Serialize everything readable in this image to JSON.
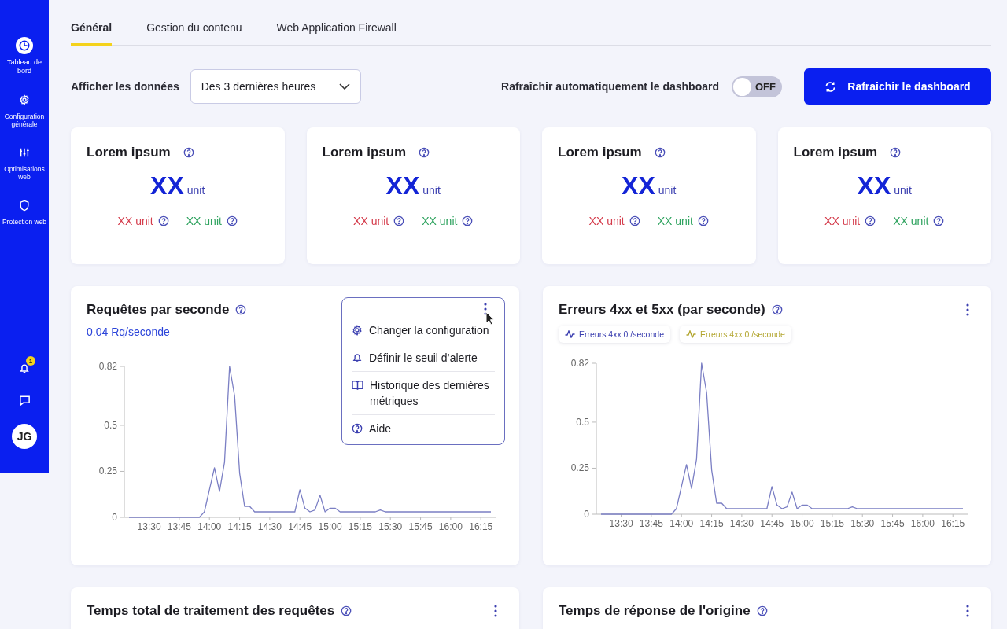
{
  "sidebar": {
    "items": [
      {
        "label": "Tableau de bord",
        "selected": true
      },
      {
        "label": "Configuration générale",
        "selected": false
      },
      {
        "label": "Optimisations web",
        "selected": false
      },
      {
        "label": "Protection web",
        "selected": false
      }
    ],
    "notifications": {
      "badge": "1"
    },
    "avatar": "JG"
  },
  "tabs": [
    {
      "label": "Général",
      "selected": true
    },
    {
      "label": "Gestion du contenu",
      "selected": false
    },
    {
      "label": "Web Application Firewall",
      "selected": false
    }
  ],
  "toolbar": {
    "range_label": "Afficher les données",
    "range_value": "Des 3 dernières heures",
    "auto_refresh_label": "Rafraîchir automatiquement le dashboard",
    "auto_refresh": {
      "on": false,
      "label": "OFF"
    },
    "refresh_button": "Rafraichir le dashboard"
  },
  "stats": [
    {
      "title": "Lorem ipsum",
      "value": "XX",
      "unit": "unit",
      "bad": "XX unit",
      "good": "XX unit"
    },
    {
      "title": "Lorem ipsum",
      "value": "XX",
      "unit": "unit",
      "bad": "XX unit",
      "good": "XX unit"
    },
    {
      "title": "Lorem ipsum",
      "value": "XX",
      "unit": "unit",
      "bad": "XX unit",
      "good": "XX unit"
    },
    {
      "title": "Lorem ipsum",
      "value": "XX",
      "unit": "unit",
      "bad": "XX unit",
      "good": "XX unit"
    }
  ],
  "panels": [
    {
      "title": "Requêtes par seconde",
      "subtitle": "0.04 Rq/seconde",
      "menu": [
        {
          "label": "Changer la configuration"
        },
        {
          "label": "Définir le seuil d’alerte"
        },
        {
          "label": "Historique des dernières métriques"
        },
        {
          "label": "Aide"
        }
      ],
      "chart_data": {
        "type": "line",
        "categories": [
          null,
          null,
          null,
          null,
          "13:30",
          null,
          null,
          null,
          null,
          null,
          "13:45",
          null,
          null,
          null,
          null,
          null,
          "14:00",
          null,
          null,
          null,
          null,
          null,
          "14:15",
          null,
          null,
          null,
          null,
          null,
          "14:30",
          null,
          null,
          null,
          null,
          null,
          "14:45",
          null,
          null,
          null,
          null,
          null,
          "15:00",
          null,
          null,
          null,
          null,
          null,
          "15:15",
          null,
          null,
          null,
          null,
          null,
          "15:30",
          null,
          null,
          null,
          null,
          null,
          "15:45",
          null,
          null,
          null,
          null,
          null,
          "16:00",
          null,
          null,
          null,
          null,
          null,
          "16:15",
          null,
          null
        ],
        "series": [
          {
            "color": "#7b7fc4",
            "values": [
              0,
              0,
              0,
              0,
              0,
              0,
              0,
              0,
              0,
              0,
              0,
              0,
              0,
              0,
              0,
              0.03,
              0.15,
              0.27,
              0.14,
              0.3,
              0.82,
              0.66,
              0.24,
              0.06,
              0.06,
              0.03,
              0.03,
              0.03,
              0.03,
              0.03,
              0.03,
              0.03,
              0.03,
              0.03,
              0.15,
              0.05,
              0.03,
              0.04,
              0.12,
              0.03,
              0.05,
              0.05,
              0.03,
              0.03,
              0.03,
              0.03,
              0.03,
              0.03,
              0.03,
              0.03,
              0.04,
              0.03,
              0.03,
              0.03,
              0.03,
              0.03,
              0.03,
              0.03,
              0.03,
              0.03,
              0.03,
              0.03,
              0.03,
              0.03,
              0.03,
              0.03,
              0.03,
              0.03,
              0.03,
              0.03,
              0.03,
              0.03,
              0.03
            ]
          }
        ],
        "ylim": [
          0,
          0.82
        ],
        "yticks": [
          0,
          0.25,
          0.5,
          0.82
        ]
      }
    },
    {
      "title": "Erreurs 4xx et 5xx (par seconde)",
      "legend": [
        {
          "label": "Erreurs 4xx 0 /seconde",
          "color": "#3b3fb0"
        },
        {
          "label": "Erreurs 4xx 0 /seconde",
          "color": "#b3a630"
        }
      ],
      "chart_data": {
        "type": "line",
        "categories": [
          null,
          null,
          null,
          null,
          "13:30",
          null,
          null,
          null,
          null,
          null,
          "13:45",
          null,
          null,
          null,
          null,
          null,
          "14:00",
          null,
          null,
          null,
          null,
          null,
          "14:15",
          null,
          null,
          null,
          null,
          null,
          "14:30",
          null,
          null,
          null,
          null,
          null,
          "14:45",
          null,
          null,
          null,
          null,
          null,
          "15:00",
          null,
          null,
          null,
          null,
          null,
          "15:15",
          null,
          null,
          null,
          null,
          null,
          "15:30",
          null,
          null,
          null,
          null,
          null,
          "15:45",
          null,
          null,
          null,
          null,
          null,
          "16:00",
          null,
          null,
          null,
          null,
          null,
          "16:15",
          null,
          null
        ],
        "series": [
          {
            "color": "#7b7fc4",
            "values": [
              0,
              0,
              0,
              0,
              0,
              0,
              0,
              0,
              0,
              0,
              0,
              0,
              0,
              0,
              0,
              0.03,
              0.15,
              0.27,
              0.14,
              0.3,
              0.82,
              0.66,
              0.24,
              0.06,
              0.06,
              0.03,
              0.03,
              0.03,
              0.03,
              0.03,
              0.03,
              0.03,
              0.03,
              0.03,
              0.15,
              0.05,
              0.03,
              0.04,
              0.12,
              0.03,
              0.05,
              0.05,
              0.03,
              0.03,
              0.03,
              0.03,
              0.03,
              0.03,
              0.03,
              0.03,
              0.04,
              0.03,
              0.03,
              0.03,
              0.03,
              0.03,
              0.03,
              0.03,
              0.03,
              0.03,
              0.03,
              0.03,
              0.03,
              0.03,
              0.03,
              0.03,
              0.03,
              0.03,
              0.03,
              0.03,
              0.03,
              0.03,
              0.03
            ]
          }
        ],
        "ylim": [
          0,
          0.82
        ],
        "yticks": [
          0,
          0.25,
          0.5,
          0.82
        ]
      }
    },
    {
      "title": "Temps total de traitement des requêtes"
    },
    {
      "title": "Temps de réponse de l'origine"
    }
  ]
}
